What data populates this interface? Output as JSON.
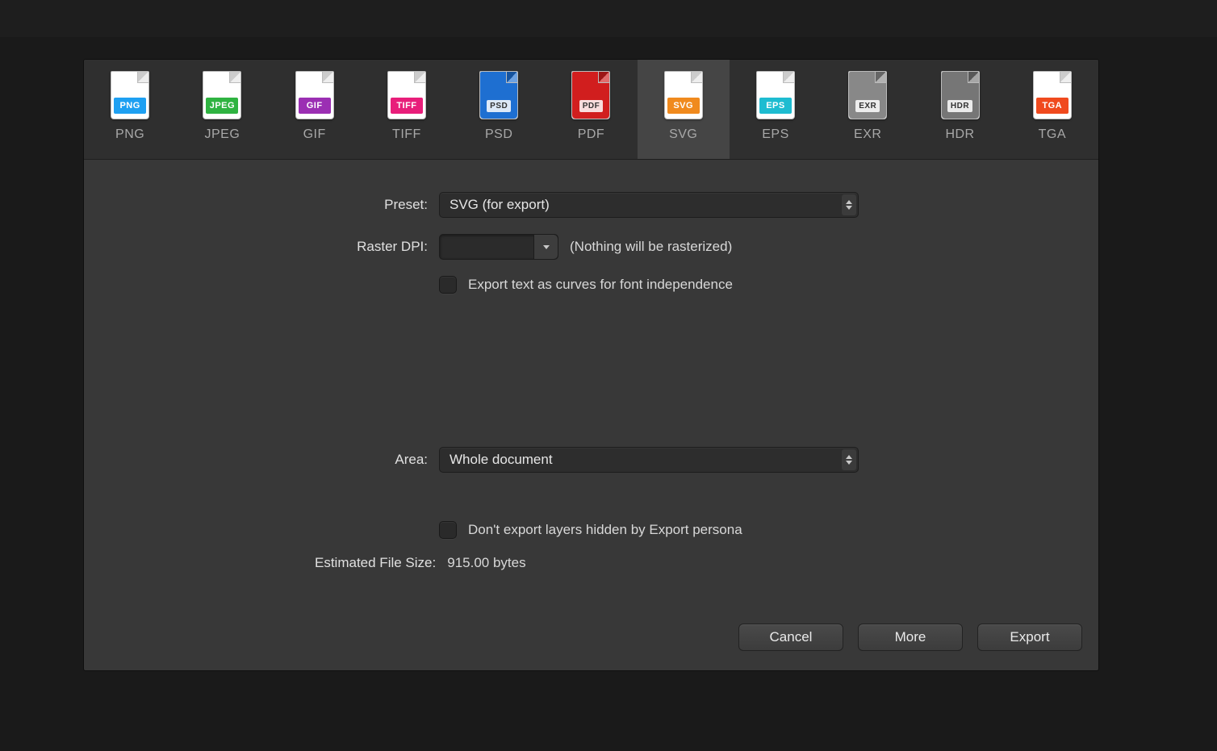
{
  "formats": [
    {
      "id": "png",
      "label": "PNG",
      "band": "PNG",
      "color": "#1ea0f2",
      "full": false
    },
    {
      "id": "jpeg",
      "label": "JPEG",
      "band": "JPEG",
      "color": "#2fb341",
      "full": false
    },
    {
      "id": "gif",
      "label": "GIF",
      "band": "GIF",
      "color": "#9b2fb3",
      "full": false
    },
    {
      "id": "tiff",
      "label": "TIFF",
      "band": "TIFF",
      "color": "#e81e7a",
      "full": false
    },
    {
      "id": "psd",
      "label": "PSD",
      "band": "PSD",
      "color": "#1e6fd1",
      "full": true
    },
    {
      "id": "pdf",
      "label": "PDF",
      "band": "PDF",
      "color": "#d11e1e",
      "full": true
    },
    {
      "id": "svg",
      "label": "SVG",
      "band": "SVG",
      "color": "#f08a1e",
      "full": false,
      "selected": true
    },
    {
      "id": "eps",
      "label": "EPS",
      "band": "EPS",
      "color": "#1ebcd1",
      "full": false
    },
    {
      "id": "exr",
      "label": "EXR",
      "band": "EXR",
      "color": "#888888",
      "full": true
    },
    {
      "id": "hdr",
      "label": "HDR",
      "band": "HDR",
      "color": "#767676",
      "full": true
    },
    {
      "id": "tga",
      "label": "TGA",
      "band": "TGA",
      "color": "#f04a1e",
      "full": false
    }
  ],
  "fields": {
    "preset_label": "Preset:",
    "preset_value": "SVG (for export)",
    "rasterdpi_label": "Raster DPI:",
    "rasterdpi_value": "",
    "rasterdpi_hint": "(Nothing will be rasterized)",
    "export_curves_label": "Export text as curves for font independence",
    "area_label": "Area:",
    "area_value": "Whole document",
    "hide_layers_label": "Don't export layers hidden by Export persona",
    "filesize_label": "Estimated File Size:",
    "filesize_value": "915.00 bytes"
  },
  "buttons": {
    "cancel": "Cancel",
    "more": "More",
    "export": "Export"
  }
}
